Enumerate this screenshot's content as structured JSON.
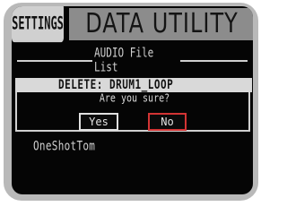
{
  "header": {
    "settings_label": "SETTINGS",
    "title": "DATA UTILITY"
  },
  "section": {
    "title": "AUDIO File List"
  },
  "dialog": {
    "item_label": "DELETE: DRUM1_LOOP",
    "prompt": "Are you sure?",
    "yes_label": "Yes",
    "no_label": "No"
  },
  "list": {
    "items": [
      "OneShotTom"
    ]
  },
  "colors": {
    "screen_bg": "#050505",
    "bezel": "#b9b9b9",
    "title_band": "#8c8c8c",
    "selected_button_border": "#d23434"
  }
}
